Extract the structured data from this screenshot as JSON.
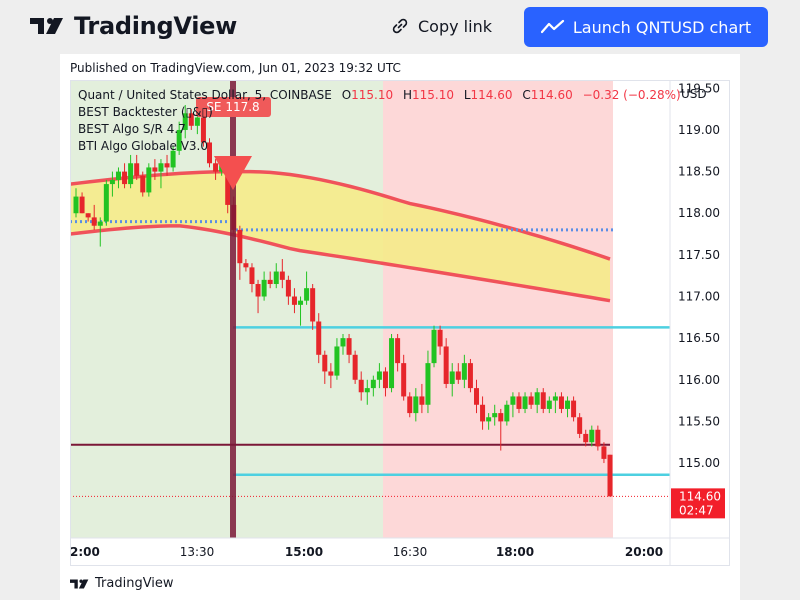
{
  "header": {
    "brand": "TradingView",
    "copy_link_label": "Copy link",
    "launch_label": "Launch QNTUSD chart",
    "colors": {
      "launch_bg": "#2962ff"
    }
  },
  "published": "Published on TradingView.com, Jun 01, 2023 19:32 UTC",
  "footer": {
    "brand": "TradingView"
  },
  "chart_data": {
    "type": "candlestick",
    "symbol_line": "Quant / United States Dollar, 5, COINBASE",
    "ohlc": {
      "o_label": "O",
      "o": "115.10",
      "h_label": "H",
      "h": "115.10",
      "l_label": "L",
      "l": "114.60",
      "c_label": "C",
      "c": "114.60",
      "change": "−0.32 (−0.28%)"
    },
    "indicators": [
      "BEST Backtester (▯&▯)",
      "BEST Algo S/R 4.7",
      "BTI Algo Globale V3.0"
    ],
    "signal_label": "SE 117.8",
    "currency": "USD",
    "y_ticks": [
      "119.50",
      "119.00",
      "118.50",
      "118.00",
      "117.50",
      "117.00",
      "116.50",
      "116.00",
      "115.50",
      "115.00"
    ],
    "x_ticks": [
      "2:00",
      "13:30",
      "15:00",
      "16:30",
      "18:00",
      "20:00"
    ],
    "ylim": [
      114.1,
      119.6
    ],
    "price_label": "114.60",
    "countdown": "02:47",
    "levels": {
      "cyan_upper": 116.63,
      "cyan_lower": 114.86,
      "maroon": 115.22,
      "dotted_blue_left": 117.9,
      "dotted_blue_right": 117.8,
      "last_price": 114.6
    },
    "colors": {
      "up": "#22c322",
      "down": "#e6262b",
      "cyan": "#4dd0e1",
      "maroon": "#7b1737",
      "band": "#f5eb8a",
      "band_edge": "#f0525a",
      "bg_green": "#e3efdc",
      "bg_red": "#fdd8d8",
      "dots": "#5b8ee6"
    },
    "candles": [
      [
        118.0,
        118.3,
        117.95,
        118.2
      ],
      [
        118.2,
        118.25,
        118.0,
        118.0
      ],
      [
        118.0,
        118.0,
        117.9,
        117.95
      ],
      [
        117.95,
        118.1,
        117.8,
        117.85
      ],
      [
        117.85,
        117.95,
        117.6,
        117.9
      ],
      [
        117.9,
        118.4,
        117.85,
        118.35
      ],
      [
        118.35,
        118.5,
        118.2,
        118.4
      ],
      [
        118.4,
        118.55,
        118.3,
        118.5
      ],
      [
        118.5,
        118.6,
        118.3,
        118.35
      ],
      [
        118.35,
        118.7,
        118.3,
        118.6
      ],
      [
        118.6,
        118.7,
        118.4,
        118.45
      ],
      [
        118.45,
        118.5,
        118.2,
        118.25
      ],
      [
        118.25,
        118.6,
        118.2,
        118.55
      ],
      [
        118.55,
        118.65,
        118.4,
        118.5
      ],
      [
        118.5,
        118.65,
        118.3,
        118.6
      ],
      [
        118.6,
        118.7,
        118.45,
        118.55
      ],
      [
        118.55,
        118.8,
        118.5,
        118.75
      ],
      [
        118.75,
        119.1,
        118.7,
        119.0
      ],
      [
        119.0,
        119.3,
        118.9,
        119.2
      ],
      [
        119.2,
        119.25,
        119.0,
        119.05
      ],
      [
        119.05,
        119.2,
        118.95,
        119.15
      ],
      [
        119.15,
        119.2,
        118.8,
        118.85
      ],
      [
        118.85,
        118.9,
        118.55,
        118.6
      ],
      [
        118.6,
        118.65,
        118.4,
        118.5
      ],
      [
        118.5,
        118.65,
        118.45,
        118.6
      ],
      [
        118.6,
        118.65,
        118.0,
        118.1
      ],
      [
        118.1,
        118.2,
        117.75,
        117.8
      ],
      [
        117.8,
        117.85,
        117.2,
        117.4
      ],
      [
        117.4,
        117.45,
        117.3,
        117.35
      ],
      [
        117.35,
        117.4,
        117.05,
        117.15
      ],
      [
        117.15,
        117.2,
        116.8,
        117.0
      ],
      [
        117.0,
        117.3,
        116.95,
        117.2
      ],
      [
        117.2,
        117.3,
        117.1,
        117.15
      ],
      [
        117.15,
        117.4,
        117.1,
        117.3
      ],
      [
        117.3,
        117.45,
        117.1,
        117.2
      ],
      [
        117.2,
        117.25,
        116.9,
        117.0
      ],
      [
        117.0,
        117.1,
        116.8,
        116.9
      ],
      [
        116.9,
        117.0,
        116.65,
        116.95
      ],
      [
        116.95,
        117.3,
        116.9,
        117.1
      ],
      [
        117.1,
        117.15,
        116.6,
        116.7
      ],
      [
        116.7,
        116.8,
        116.2,
        116.3
      ],
      [
        116.3,
        116.35,
        115.95,
        116.1
      ],
      [
        116.1,
        116.2,
        115.9,
        116.05
      ],
      [
        116.05,
        116.5,
        116.0,
        116.4
      ],
      [
        116.4,
        116.55,
        116.3,
        116.5
      ],
      [
        116.5,
        116.55,
        116.2,
        116.3
      ],
      [
        116.3,
        116.35,
        115.95,
        116.0
      ],
      [
        116.0,
        116.1,
        115.75,
        115.85
      ],
      [
        115.85,
        116.0,
        115.7,
        115.9
      ],
      [
        115.9,
        116.05,
        115.8,
        116.0
      ],
      [
        116.0,
        116.2,
        115.9,
        116.1
      ],
      [
        116.1,
        116.15,
        115.8,
        115.9
      ],
      [
        115.9,
        116.55,
        115.85,
        116.5
      ],
      [
        116.5,
        116.55,
        116.1,
        116.2
      ],
      [
        116.2,
        116.3,
        115.75,
        115.8
      ],
      [
        115.8,
        115.85,
        115.55,
        115.6
      ],
      [
        115.6,
        115.9,
        115.5,
        115.8
      ],
      [
        115.8,
        115.95,
        115.6,
        115.7
      ],
      [
        115.7,
        116.35,
        115.6,
        116.2
      ],
      [
        116.2,
        116.65,
        116.15,
        116.6
      ],
      [
        116.6,
        116.65,
        116.3,
        116.4
      ],
      [
        116.4,
        116.5,
        115.9,
        115.95
      ],
      [
        115.95,
        116.2,
        115.8,
        116.1
      ],
      [
        116.1,
        116.2,
        115.95,
        116.0
      ],
      [
        116.0,
        116.3,
        115.9,
        116.2
      ],
      [
        116.2,
        116.25,
        115.85,
        115.9
      ],
      [
        115.9,
        116.0,
        115.6,
        115.7
      ],
      [
        115.7,
        115.8,
        115.4,
        115.5
      ],
      [
        115.5,
        115.6,
        115.4,
        115.55
      ],
      [
        115.55,
        115.7,
        115.45,
        115.6
      ],
      [
        115.6,
        115.65,
        115.15,
        115.5
      ],
      [
        115.5,
        115.75,
        115.45,
        115.7
      ],
      [
        115.7,
        115.85,
        115.55,
        115.8
      ],
      [
        115.8,
        115.85,
        115.6,
        115.65
      ],
      [
        115.65,
        115.85,
        115.6,
        115.8
      ],
      [
        115.8,
        115.85,
        115.65,
        115.7
      ],
      [
        115.7,
        115.9,
        115.6,
        115.85
      ],
      [
        115.85,
        115.9,
        115.6,
        115.65
      ],
      [
        115.65,
        115.8,
        115.6,
        115.75
      ],
      [
        115.75,
        115.85,
        115.6,
        115.8
      ],
      [
        115.8,
        115.85,
        115.6,
        115.65
      ],
      [
        115.65,
        115.8,
        115.55,
        115.75
      ],
      [
        115.75,
        115.8,
        115.5,
        115.55
      ],
      [
        115.55,
        115.6,
        115.3,
        115.35
      ],
      [
        115.35,
        115.4,
        115.2,
        115.25
      ],
      [
        115.25,
        115.45,
        115.2,
        115.4
      ],
      [
        115.4,
        115.45,
        115.15,
        115.2
      ],
      [
        115.2,
        115.25,
        115.0,
        115.05
      ],
      [
        115.1,
        115.1,
        114.6,
        114.6
      ]
    ]
  }
}
